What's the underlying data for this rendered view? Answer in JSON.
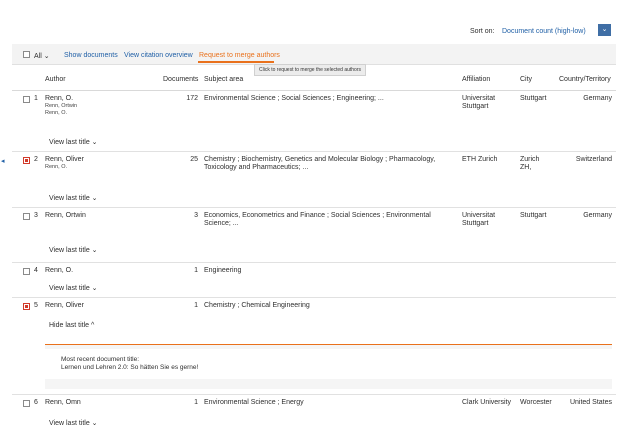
{
  "sort": {
    "label": "Sort on:",
    "value": "Document count (high-low)",
    "caret": "⌄"
  },
  "toolbar": {
    "all_label": "All",
    "all_caret": "⌄",
    "show_documents": "Show documents",
    "view_citation": "View citation overview",
    "request_merge": "Request to merge authors"
  },
  "tooltip": "Click to request to merge the selected authors",
  "columns": {
    "author": "Author",
    "documents": "Documents",
    "subject": "Subject area",
    "affiliation": "Affiliation",
    "city": "City",
    "country": "Country/Territory"
  },
  "rows": [
    {
      "num": "1",
      "author": "Renn, O.",
      "variants": [
        "Renn, Ortwin",
        "Renn, O."
      ],
      "docs": "172",
      "subject": "Environmental Science ; Social Sciences ; Engineering; ...",
      "affiliation": "Universitat Stuttgart",
      "city": "Stuttgart",
      "country": "Germany",
      "link": "View last title ⌄"
    },
    {
      "num": "2",
      "author": "Renn, Oliver",
      "variants": [
        "Renn, O."
      ],
      "docs": "25",
      "subject": "Chemistry ; Biochemistry, Genetics and Molecular Biology ; Pharmacology, Toxicology and Pharmaceutics; ...",
      "affiliation": "ETH Zurich",
      "city": "Zurich ZH,",
      "country": "Switzerland",
      "link": "View last title ⌄"
    },
    {
      "num": "3",
      "author": "Renn, Ortwin",
      "variants": [],
      "docs": "3",
      "subject": "Economics, Econometrics and Finance ; Social Sciences ; Environmental Science; ...",
      "affiliation": "Universitat Stuttgart",
      "city": "Stuttgart",
      "country": "Germany",
      "link": "View last title ⌄"
    },
    {
      "num": "4",
      "author": "Renn, O.",
      "variants": [],
      "docs": "1",
      "subject": "Engineering",
      "affiliation": "",
      "city": "",
      "country": "",
      "link": "View last title ⌄"
    },
    {
      "num": "5",
      "author": "Renn, Oliver",
      "variants": [],
      "docs": "1",
      "subject": "Chemistry ; Chemical Engineering",
      "affiliation": "",
      "city": "",
      "country": "",
      "link": "Hide last title ^"
    },
    {
      "num": "6",
      "author": "Renn, Omn",
      "variants": [],
      "docs": "1",
      "subject": "Environmental Science ; Energy",
      "affiliation": "Clark University",
      "city": "Worcester",
      "country": "United States",
      "link": "View last title ⌄"
    }
  ],
  "expanded": {
    "label": "Most recent document title:",
    "title": "Lernen und Lehren 2.0: So hätten Sie es gerne!"
  }
}
